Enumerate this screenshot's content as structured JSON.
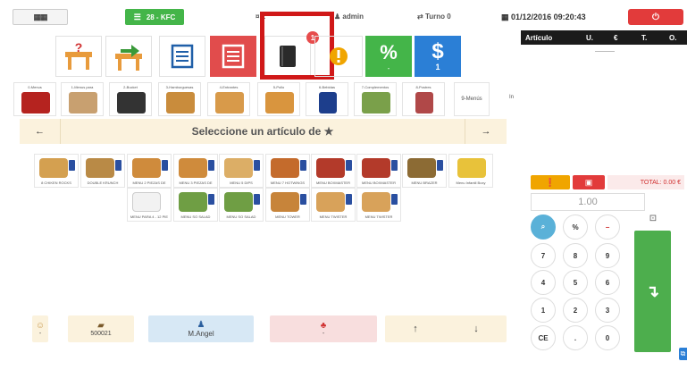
{
  "topbar": {
    "grid_icon": "grid-icon",
    "table_label": "28 - KFC",
    "station_label": "¤ 1",
    "user_label": "admin",
    "shift_label": "Turno 0",
    "datetime": "01/12/2016 09:20:43",
    "power_icon": "power-icon"
  },
  "actions": {
    "notification_count": "1",
    "percent_symbol": "%",
    "percent_sub": "-",
    "dollar_symbol": "$",
    "dollar_sub": "1"
  },
  "order_panel": {
    "columns": [
      "Artículo",
      "U.",
      "€",
      "T.",
      "O."
    ]
  },
  "categories": [
    {
      "label": "0-Menus"
    },
    {
      "label": "1-Menus para"
    },
    {
      "label": "2-Bucket"
    },
    {
      "label": "3-Hamburguesas"
    },
    {
      "label": "4-Entrantes"
    },
    {
      "label": "5-Pollo"
    },
    {
      "label": "6-Bebidas"
    },
    {
      "label": "7-Complementos"
    },
    {
      "label": "8-Postres"
    }
  ],
  "menus_label": "9-Menús",
  "edge_label": "In",
  "selector": {
    "text": "Seleccione un artículo de ★",
    "left_arrow": "←",
    "right_arrow": "→"
  },
  "products": [
    {
      "name": "8 CHIKEN ROCKS"
    },
    {
      "name": "DOUBLE KRUNCH"
    },
    {
      "name": "MENU 2 PIEZAS DE"
    },
    {
      "name": "MENU 3 PIEZAS DE"
    },
    {
      "name": "MENU 5 DIPS"
    },
    {
      "name": "MENU 7 HOTWINGS"
    },
    {
      "name": "MENU BOXMASTER"
    },
    {
      "name": "MENU BOXMASTER"
    },
    {
      "name": "MENU BRAZER"
    },
    {
      "name": "Menu Infantil Boxy"
    },
    {
      "name": "MENU PARA 4 - 12 PIE"
    },
    {
      "name": "MENU SO SALAD"
    },
    {
      "name": "MENU SO SALAD"
    },
    {
      "name": "MENU TOWER"
    },
    {
      "name": "MENU TWISTER"
    },
    {
      "name": "MENU TWISTER"
    }
  ],
  "bottom": {
    "guest_value": "-",
    "ticket_value": "500021",
    "waiter_name": "M.Angel",
    "group_value": "-",
    "up_arrow": "↑",
    "down_arrow": "↓"
  },
  "totals": {
    "total_label": "TOTAL: 0.00 €",
    "quantity": "1.00"
  },
  "keypad": {
    "percent": "%",
    "minus": "−",
    "k7": "7",
    "k8": "8",
    "k9": "9",
    "k4": "4",
    "k5": "5",
    "k6": "6",
    "k1": "1",
    "k2": "2",
    "k3": "3",
    "ce": "CE",
    "dot": ".",
    "k0": "0",
    "enter": "↴"
  },
  "colors": {
    "green": "#44b549",
    "red": "#e23b3b",
    "blue": "#2b7fd6",
    "orange": "#f0a500",
    "highlight": "#d01818"
  }
}
